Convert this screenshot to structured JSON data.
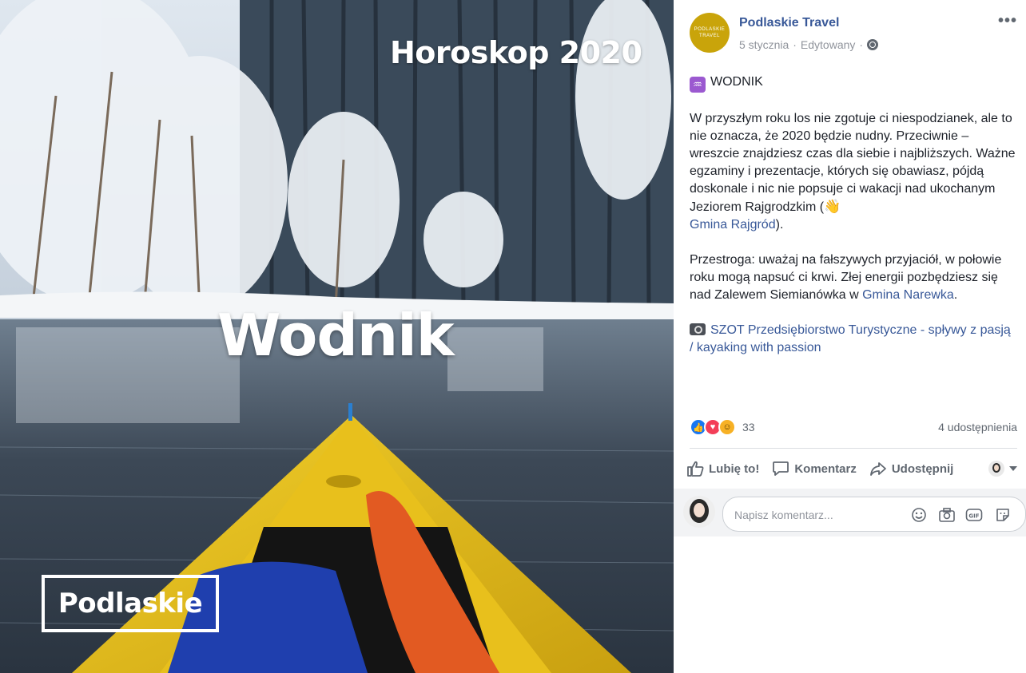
{
  "photo": {
    "overlay_title": "Horoskop 2020",
    "overlay_word": "Wodnik",
    "brand_box": "Podlaskie"
  },
  "post": {
    "avatar_line1": "PODLASKIE",
    "avatar_line2": "TRAVEL",
    "page_name": "Podlaskie Travel",
    "date": "5 stycznia",
    "sep1": "·",
    "edited": "Edytowany",
    "sep2": "·",
    "more_icon": "ellipsis-icon",
    "sign_glyph": "♒",
    "heading": "WODNIK",
    "para1_text": "W przyszłym roku los nie zgotuje ci niespodzianek, ale to nie oznacza, że 2020 będzie nudny. Przeciwnie – wreszcie znajdziesz czas dla siebie i najbliższych. Ważne egzaminy i prezentacje, których się obawiasz, pójdą doskonale i nic nie popsuje ci wakacji nad ukochanym Jeziorem Rajgrodzkim (",
    "para1_link": "Gmina Rajgród",
    "para1_end": ").",
    "para2_text": "Przestroga: uważaj na fałszywych przyjaciół, w połowie roku mogą napsuć ci krwi. Złej energii pozbędziesz się nad Zalewem Siemianówka w ",
    "para2_link": "Gmina Narewka",
    "para2_end": ".",
    "photo_credit_link": "SZOT Przedsiębiorstwo Turystyczne - spływy z pasją / kayaking with passion"
  },
  "stats": {
    "reaction_count": "33",
    "shares": "4 udostępnienia",
    "reactions": [
      "like-reaction-icon",
      "love-reaction-icon",
      "haha-reaction-icon"
    ]
  },
  "actions": {
    "like": "Lubię to!",
    "comment": "Komentarz",
    "share": "Udostępnij"
  },
  "comment": {
    "placeholder": "Napisz komentarz..."
  },
  "colors": {
    "link": "#385898",
    "avatar_gold": "#c9a40a",
    "muted": "#606770"
  }
}
